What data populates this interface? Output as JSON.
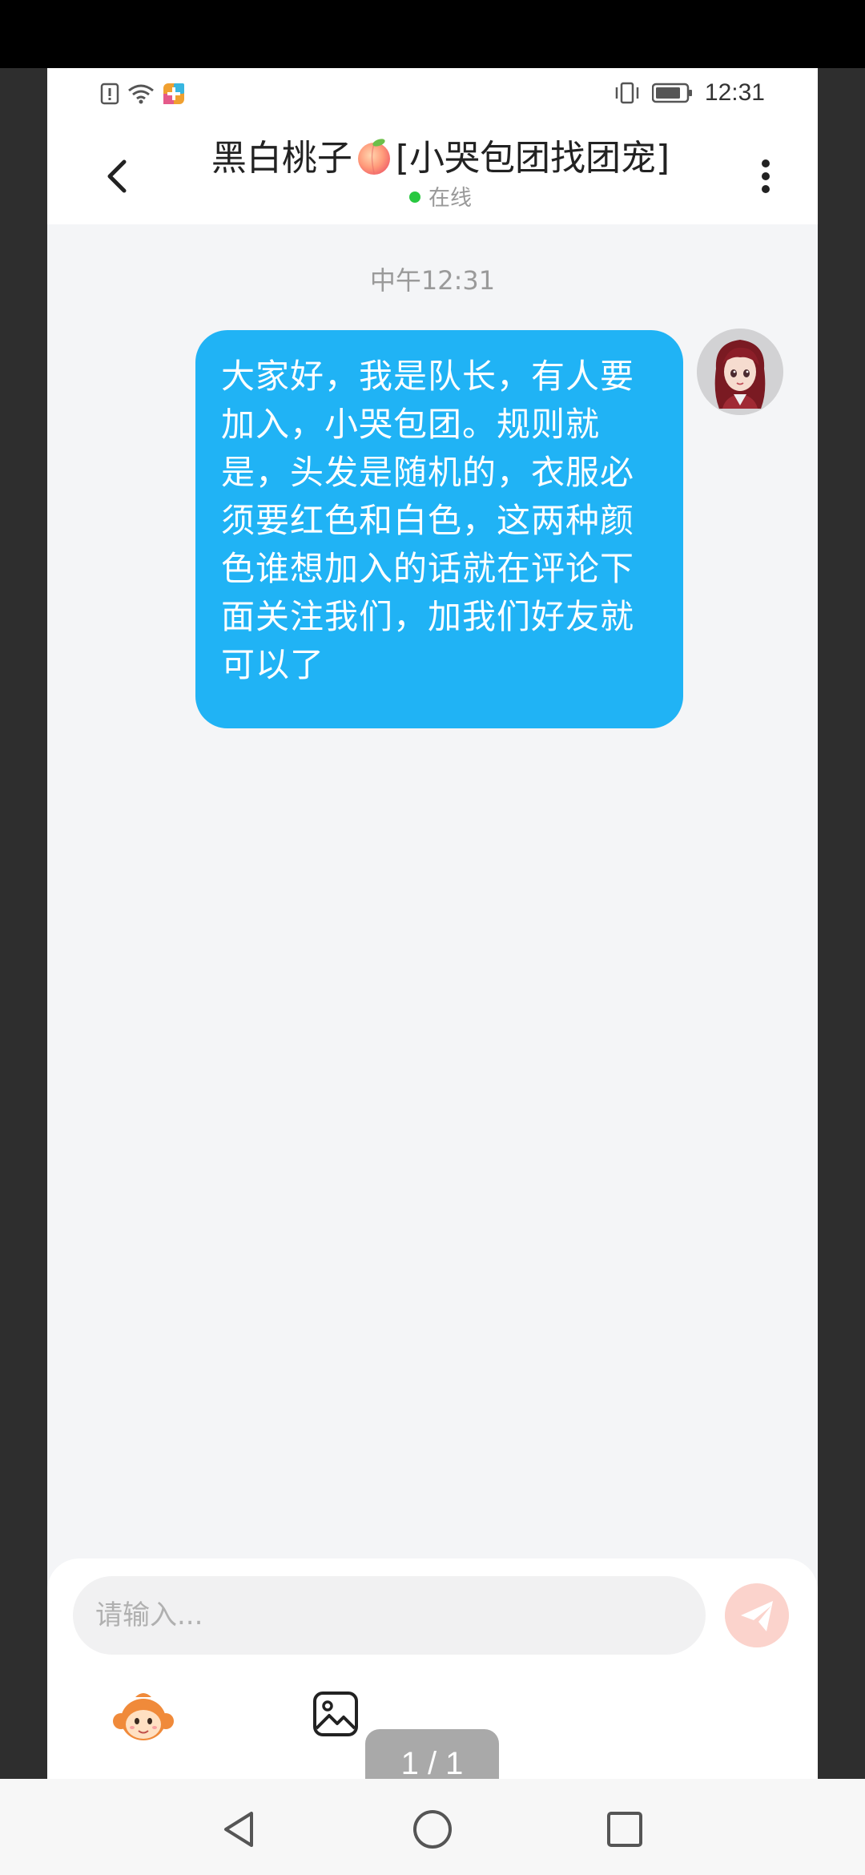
{
  "status_bar": {
    "time": "12:31",
    "icons": [
      "alert-icon",
      "wifi-icon",
      "app-notification-icon",
      "vibrate-icon",
      "battery-icon"
    ]
  },
  "header": {
    "title_part1": "黑白桃子",
    "title_emoji": "peach-emoji",
    "title_part2": "[小哭包团找团宠]",
    "status": "在线",
    "status_color": "#28c840"
  },
  "chat": {
    "time_label": "中午12:31",
    "messages": [
      {
        "sender": "self",
        "text": "大家好，我是队长，有人要加入，小哭包团。规则就是，头发是随机的，衣服必须要红色和白色，这两种颜色谁想加入的话就在评论下面关注我们，加我们好友就可以了",
        "bubble_color": "#20b3f5"
      }
    ]
  },
  "composer": {
    "placeholder": "请输入...",
    "page_indicator": "1 / 1"
  },
  "nav": {
    "icons": [
      "nav-back-icon",
      "nav-home-icon",
      "nav-recent-icon"
    ]
  }
}
